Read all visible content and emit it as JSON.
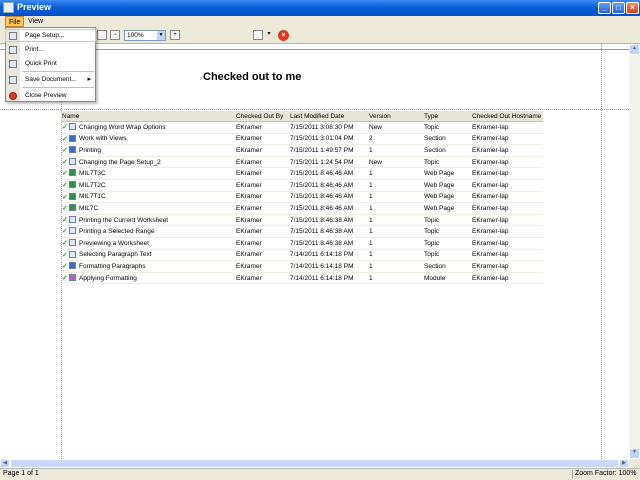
{
  "window": {
    "title": "Preview"
  },
  "menubar": {
    "file": "File",
    "view": "View"
  },
  "toolbar": {
    "zoom_value": "100%"
  },
  "file_menu": {
    "page_setup": "Page Setup...",
    "print": "Print...",
    "quick_print": "Quick Print",
    "save_document": "Save Document...",
    "close_preview": "Close Preview"
  },
  "report": {
    "title": "Checked out to me",
    "columns": [
      "Name",
      "Checked Out By",
      "Last Modified Date",
      "Version",
      "Type",
      "Checked Out Hostname"
    ],
    "rows": [
      {
        "name": "Changing Word Wrap Options",
        "by": "EKramer",
        "date": "7/15/2011 3:08:30 PM",
        "version": "New",
        "type": "Topic",
        "host": "EKramer-lap",
        "icon": "topic"
      },
      {
        "name": "Work with Views",
        "by": "EKramer",
        "date": "7/15/2011 3:01:04 PM",
        "version": "2",
        "type": "Section",
        "host": "EKramer-lap",
        "icon": "section"
      },
      {
        "name": "Printing",
        "by": "EKramer",
        "date": "7/15/2011 1:49:57 PM",
        "version": "1",
        "type": "Section",
        "host": "EKramer-lap",
        "icon": "section"
      },
      {
        "name": "Changing the Page Setup_2",
        "by": "EKramer",
        "date": "7/15/2011 1:24:54 PM",
        "version": "New",
        "type": "Topic",
        "host": "EKramer-lap",
        "icon": "topic"
      },
      {
        "name": "MIL7T3C",
        "by": "EKramer",
        "date": "7/15/2011 8:46:46 AM",
        "version": "1",
        "type": "Web Page",
        "host": "EKramer-lap",
        "icon": "webpage"
      },
      {
        "name": "MIL7T2C",
        "by": "EKramer",
        "date": "7/15/2011 8:46:46 AM",
        "version": "1",
        "type": "Web Page",
        "host": "EKramer-lap",
        "icon": "webpage"
      },
      {
        "name": "MIL7T1C",
        "by": "EKramer",
        "date": "7/15/2011 8:46:46 AM",
        "version": "1",
        "type": "Web Page",
        "host": "EKramer-lap",
        "icon": "webpage"
      },
      {
        "name": "MIL7C",
        "by": "EKramer",
        "date": "7/15/2011 8:46:46 AM",
        "version": "1",
        "type": "Web Page",
        "host": "EKramer-lap",
        "icon": "webpage"
      },
      {
        "name": "Printing the Current Worksheet",
        "by": "EKramer",
        "date": "7/15/2011 8:46:38 AM",
        "version": "1",
        "type": "Topic",
        "host": "EKramer-lap",
        "icon": "topic"
      },
      {
        "name": "Printing a Selected Range",
        "by": "EKramer",
        "date": "7/15/2011 8:46:38 AM",
        "version": "1",
        "type": "Topic",
        "host": "EKramer-lap",
        "icon": "topic"
      },
      {
        "name": "Previewing a Worksheet",
        "by": "EKramer",
        "date": "7/15/2011 8:46:38 AM",
        "version": "1",
        "type": "Topic",
        "host": "EKramer-lap",
        "icon": "topic"
      },
      {
        "name": "Selecting Paragraph Text",
        "by": "EKramer",
        "date": "7/14/2011 6:14:18 PM",
        "version": "1",
        "type": "Topic",
        "host": "EKramer-lap",
        "icon": "topic"
      },
      {
        "name": "Formatting Paragraphs",
        "by": "EKramer",
        "date": "7/14/2011 6:14:18 PM",
        "version": "1",
        "type": "Section",
        "host": "EKramer-lap",
        "icon": "section"
      },
      {
        "name": "Applying Formatting",
        "by": "EKramer",
        "date": "7/14/2011 6:14:18 PM",
        "version": "1",
        "type": "Module",
        "host": "EKramer-lap",
        "icon": "module"
      }
    ]
  },
  "status": {
    "page": "Page 1 of 1",
    "zoom": "Zoom Factor: 100%"
  }
}
